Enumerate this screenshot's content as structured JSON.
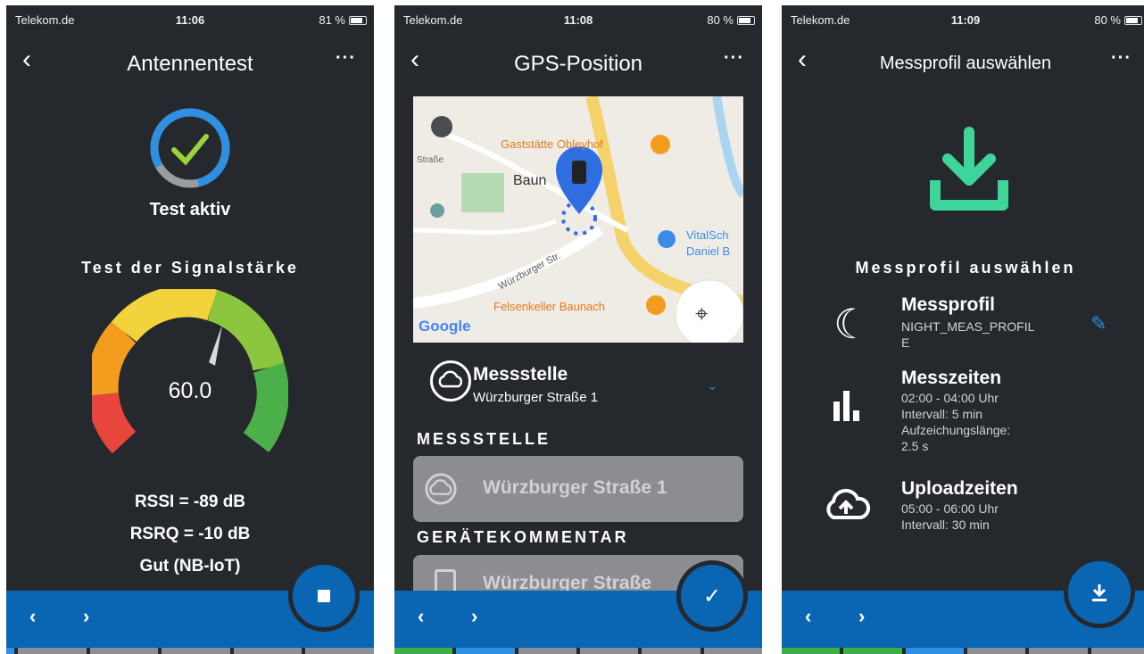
{
  "status_bars": [
    {
      "carrier": "Telekom.de",
      "time": "11:06",
      "battery": "81 %"
    },
    {
      "carrier": "Telekom.de",
      "time": "11:08",
      "battery": "80 %"
    },
    {
      "carrier": "Telekom.de",
      "time": "11:09",
      "battery": "80 %"
    }
  ],
  "screen1": {
    "title": "Antennentest",
    "status": "Test aktiv",
    "section_title": "Test der Signalstärke",
    "gauge_value": "60.0",
    "rssi": "RSSI = -89 dB",
    "rsrq": "RSRQ = -10 dB",
    "quality": "Gut (NB-IoT)"
  },
  "screen2": {
    "title": "GPS-Position",
    "map_labels": {
      "poi1": "Gaststätte Obleyhof",
      "town": "Baun",
      "street_left": "Straße",
      "street_main": "Würzburger Str.",
      "poi2": "VitalSch",
      "poi2b": "Daniel B",
      "poi3": "Felsenkeller Baunach",
      "google": "Google"
    },
    "location_title": "Messstelle",
    "location_sub": "Würzburger Straße 1",
    "section1": "MESSSTELLE",
    "field1": "Würzburger Straße 1",
    "section2": "GERÄTEKOMMENTAR",
    "field2": "Würzburger Straße"
  },
  "screen3": {
    "title": "Messprofil auswählen",
    "section_title": "Messprofil auswählen",
    "profile_label": "Messprofil",
    "profile_value_1": "NIGHT_MEAS_PROFIL",
    "profile_value_2": "E",
    "times_label": "Messzeiten",
    "times_1": "02:00 - 04:00 Uhr",
    "times_2": "Intervall: 5 min",
    "times_3": "Aufzeichungslänge:",
    "times_4": "2.5 s",
    "upload_label": "Uploadzeiten",
    "upload_1": "05:00 - 06:00 Uhr",
    "upload_2": "Intervall: 30 min"
  },
  "colors": {
    "accent": "#0a66b3",
    "bg": "#25282d",
    "success": "#3ed59b",
    "link": "#2f8fe0"
  }
}
